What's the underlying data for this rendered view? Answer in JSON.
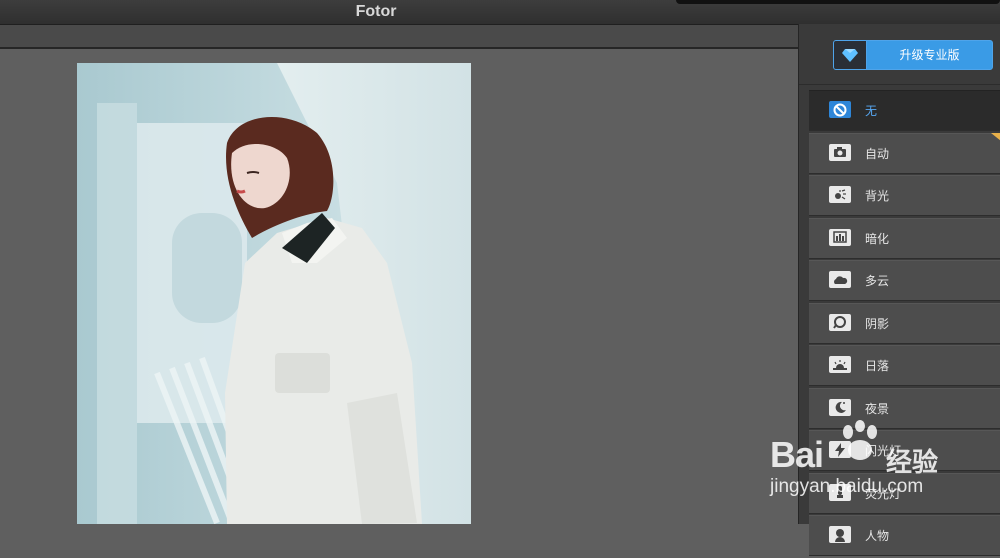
{
  "window": {
    "title": "Fotor"
  },
  "sidebar": {
    "upgrade_label": "升级专业版",
    "scenes": [
      {
        "label": "无",
        "icon": "none-icon",
        "selected": true
      },
      {
        "label": "自动",
        "icon": "camera-icon"
      },
      {
        "label": "背光",
        "icon": "backlight-icon"
      },
      {
        "label": "暗化",
        "icon": "darken-icon"
      },
      {
        "label": "多云",
        "icon": "cloud-icon"
      },
      {
        "label": "阴影",
        "icon": "shadow-icon"
      },
      {
        "label": "日落",
        "icon": "sunset-icon"
      },
      {
        "label": "夜景",
        "icon": "night-icon"
      },
      {
        "label": "闪光灯",
        "icon": "flash-icon"
      },
      {
        "label": "荧光灯",
        "icon": "fluorescent-icon"
      },
      {
        "label": "人物",
        "icon": "portrait-icon"
      }
    ]
  },
  "watermark": {
    "brand": "Bai",
    "brand2": "经验",
    "url": "jingyan.baidu.com"
  },
  "colors": {
    "accent": "#3a9be6",
    "selected_label": "#57a9f5",
    "panel": "#3a3a3a",
    "workspace": "#5f5f5f"
  }
}
